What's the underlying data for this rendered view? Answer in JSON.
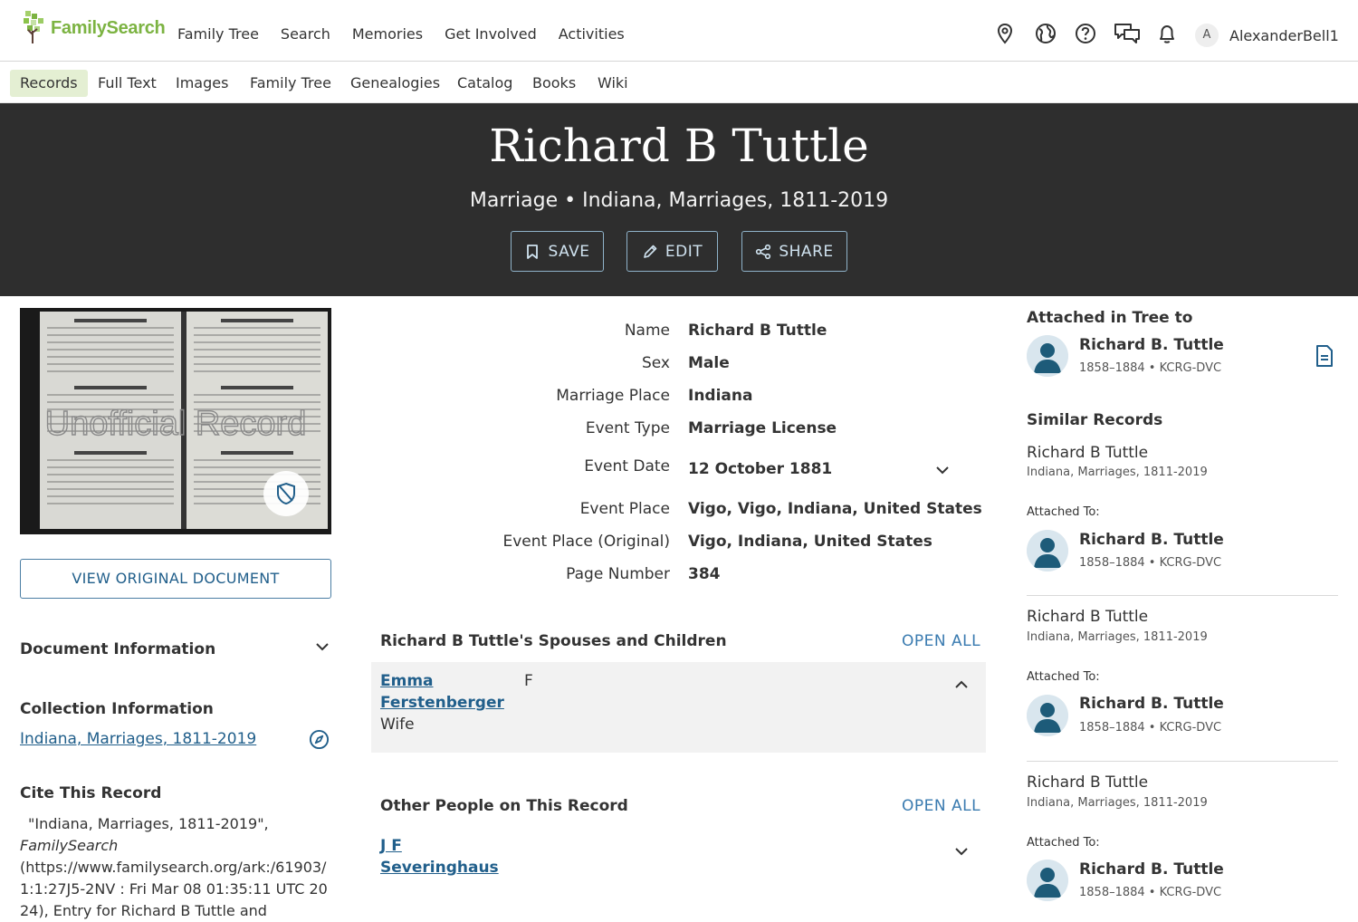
{
  "app": {
    "logo_text": "FamilySearch",
    "main_nav": [
      "Family Tree",
      "Search",
      "Memories",
      "Get Involved",
      "Activities"
    ],
    "user": {
      "initial": "A",
      "name": "AlexanderBell1"
    },
    "icons": [
      "location-pin-icon",
      "globe-icon",
      "help-icon",
      "chat-icon",
      "bell-icon"
    ]
  },
  "sub_nav": {
    "items": [
      "Records",
      "Full Text",
      "Images",
      "Family Tree",
      "Genealogies",
      "Catalog",
      "Books",
      "Wiki"
    ],
    "active": "Records"
  },
  "hero": {
    "title": "Richard B Tuttle",
    "subtitle": "Marriage • Indiana, Marriages, 1811-2019",
    "buttons": {
      "save": "SAVE",
      "edit": "EDIT",
      "share": "SHARE"
    }
  },
  "left": {
    "image_watermark": "Unofficial Record",
    "view_button": "VIEW ORIGINAL DOCUMENT",
    "document_info": "Document Information",
    "collection_info": "Collection Information",
    "collection_link": "Indiana, Marriages, 1811-2019",
    "cite_title": "Cite This Record",
    "cite_line1": "\"Indiana, Marriages, 1811-2019\",",
    "cite_italic": "FamilySearch",
    "cite_rest": "(https://www.familysearch.org/ark:/61903/1:1:27J5-2NV : Fri Mar 08 01:35:11 UTC 2024), Entry for Richard B Tuttle and"
  },
  "facts": [
    {
      "label": "Name",
      "value": "Richard B Tuttle"
    },
    {
      "label": "Sex",
      "value": "Male"
    },
    {
      "label": "Marriage Place",
      "value": "Indiana"
    },
    {
      "label": "Event Type",
      "value": "Marriage License"
    },
    {
      "label": "Event Date",
      "value": "12 October 1881"
    },
    {
      "label": "Event Place",
      "value": "Vigo, Vigo, Indiana, United States"
    },
    {
      "label": "Event Place (Original)",
      "value": "Vigo, Indiana, United States"
    },
    {
      "label": "Page Number",
      "value": "384"
    }
  ],
  "spouses": {
    "title": "Richard B Tuttle's Spouses and Children",
    "open_all": "OPEN ALL",
    "person": {
      "name_line1": "Emma",
      "name_line2": "Ferstenberger",
      "relation": "Wife",
      "sex": "F"
    }
  },
  "others": {
    "title": "Other People on This Record",
    "open_all": "OPEN ALL",
    "person": {
      "name_line1": "J F",
      "name_line2": "Severinghaus"
    }
  },
  "right": {
    "attached_title": "Attached in Tree to",
    "attached_person": {
      "name": "Richard B. Tuttle",
      "meta": "1858–1884 • KCRG-DVC"
    },
    "similar_title": "Similar Records",
    "attached_to_label": "Attached To:",
    "similar": [
      {
        "name": "Richard B Tuttle",
        "collection": "Indiana, Marriages, 1811-2019",
        "person": "Richard B. Tuttle",
        "meta": "1858–1884 • KCRG-DVC"
      },
      {
        "name": "Richard B Tuttle",
        "collection": "Indiana, Marriages, 1811-2019",
        "person": "Richard B. Tuttle",
        "meta": "1858–1884 • KCRG-DVC"
      },
      {
        "name": "Richard B Tuttle",
        "collection": "Indiana, Marriages, 1811-2019",
        "person": "Richard B. Tuttle",
        "meta": "1858–1884 • KCRG-DVC"
      }
    ]
  },
  "colors": {
    "accent_green": "#7cb342",
    "link_blue": "#215f8b",
    "hero_bg": "#2e2e2e",
    "active_tab_bg": "#e4efd3"
  }
}
